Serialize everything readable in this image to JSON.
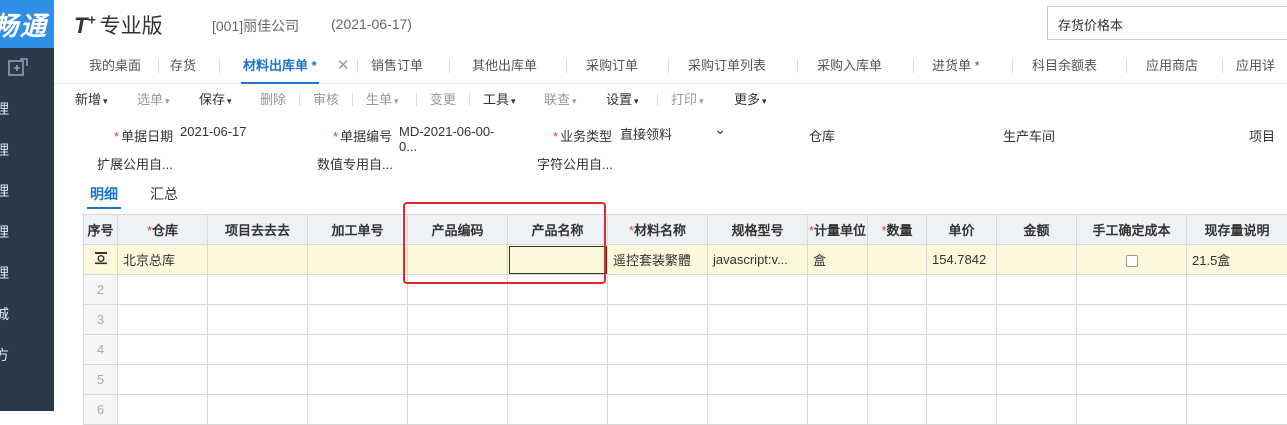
{
  "sidebar": {
    "logo": "畅通",
    "items": [
      "理",
      "理",
      "理",
      "理",
      "理",
      "城",
      "方"
    ]
  },
  "header": {
    "brand_t": "T",
    "brand_plus": "+",
    "brand_cn": "专业版",
    "company": "[001]丽佳公司",
    "date": "(2021-06-17)",
    "search_value": "存货价格本"
  },
  "tabs": [
    "我的桌面",
    "存货",
    "材料出库单 *",
    "销售订单",
    "其他出库单",
    "采购订单",
    "采购订单列表",
    "采购入库单",
    "进货单 *",
    "科目余额表",
    "应用商店",
    "应用详"
  ],
  "tab_close": "✕",
  "toolbar": {
    "add": "新增",
    "select": "选单",
    "save": "保存",
    "delete": "删除",
    "audit": "审核",
    "generate": "生单",
    "change": "变更",
    "tools": "工具",
    "linkquery": "联查",
    "settings": "设置",
    "print": "打印",
    "more": "更多",
    "caret": "▾"
  },
  "form": {
    "date_label": "单据日期",
    "date_value": "2021-06-17",
    "code_label": "单据编号",
    "code_value": "MD-2021-06-00-0...",
    "biztype_label": "业务类型",
    "biztype_value": "直接领料",
    "warehouse_label": "仓库",
    "workshop_label": "生产车间",
    "project_label": "项目",
    "ext_label": "扩展公用自...",
    "numeric_label": "数值专用自...",
    "char_label": "字符公用自...",
    "required_mark": "*",
    "dropdown_caret": "⌄"
  },
  "subtabs": {
    "detail": "明细",
    "summary": "汇总"
  },
  "grid": {
    "headers": [
      "序号",
      "仓库",
      "项目去去去",
      "加工单号",
      "产品编码",
      "产品名称",
      "材料名称",
      "规格型号",
      "计量单位",
      "数量",
      "单价",
      "金额",
      "手工确定成本",
      "现存量说明"
    ],
    "required_mark": "*",
    "row1": {
      "warehouse": "北京总库",
      "project": "",
      "process_no": "",
      "product_code": "",
      "product_name": "",
      "material_name": "遥控套装繁體",
      "spec": "javascript:v...",
      "unit": "盒",
      "qty": "",
      "price": "154.7842",
      "amount": "",
      "stock_desc": "21.5盒"
    },
    "row_numbers": [
      "2",
      "3",
      "4",
      "5",
      "6"
    ]
  }
}
